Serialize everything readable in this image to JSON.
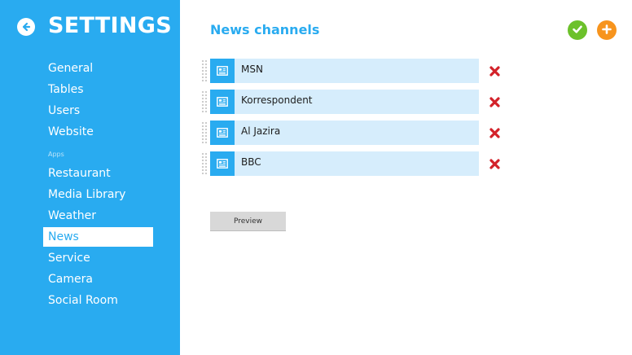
{
  "sidebar": {
    "title": "SETTINGS",
    "back_icon": "arrow-left-icon",
    "items": [
      {
        "label": "General"
      },
      {
        "label": "Tables"
      },
      {
        "label": "Users"
      },
      {
        "label": "Website"
      },
      {
        "section": "Apps"
      },
      {
        "label": "Restaurant"
      },
      {
        "label": "Media Library"
      },
      {
        "label": "Weather"
      },
      {
        "label": "News",
        "active": true
      },
      {
        "label": "Service"
      },
      {
        "label": "Camera"
      },
      {
        "label": "Social Room"
      }
    ]
  },
  "main": {
    "title": "News channels",
    "actions": {
      "confirm_icon": "checkmark-icon",
      "add_icon": "plus-icon"
    },
    "channels": [
      {
        "name": "MSN",
        "icon": "news-icon"
      },
      {
        "name": "Korrespondent",
        "icon": "news-icon"
      },
      {
        "name": "Al Jazira",
        "icon": "news-icon"
      },
      {
        "name": "BBC",
        "icon": "news-icon"
      }
    ],
    "delete_icon": "delete-x-icon",
    "preview_label": "Preview"
  },
  "colors": {
    "sidebar_bg": "#29abf0",
    "accent": "#29abf0",
    "row_bg": "#d6edfc",
    "confirm": "#6cc12b",
    "add": "#f7941d",
    "delete": "#d3222a"
  }
}
